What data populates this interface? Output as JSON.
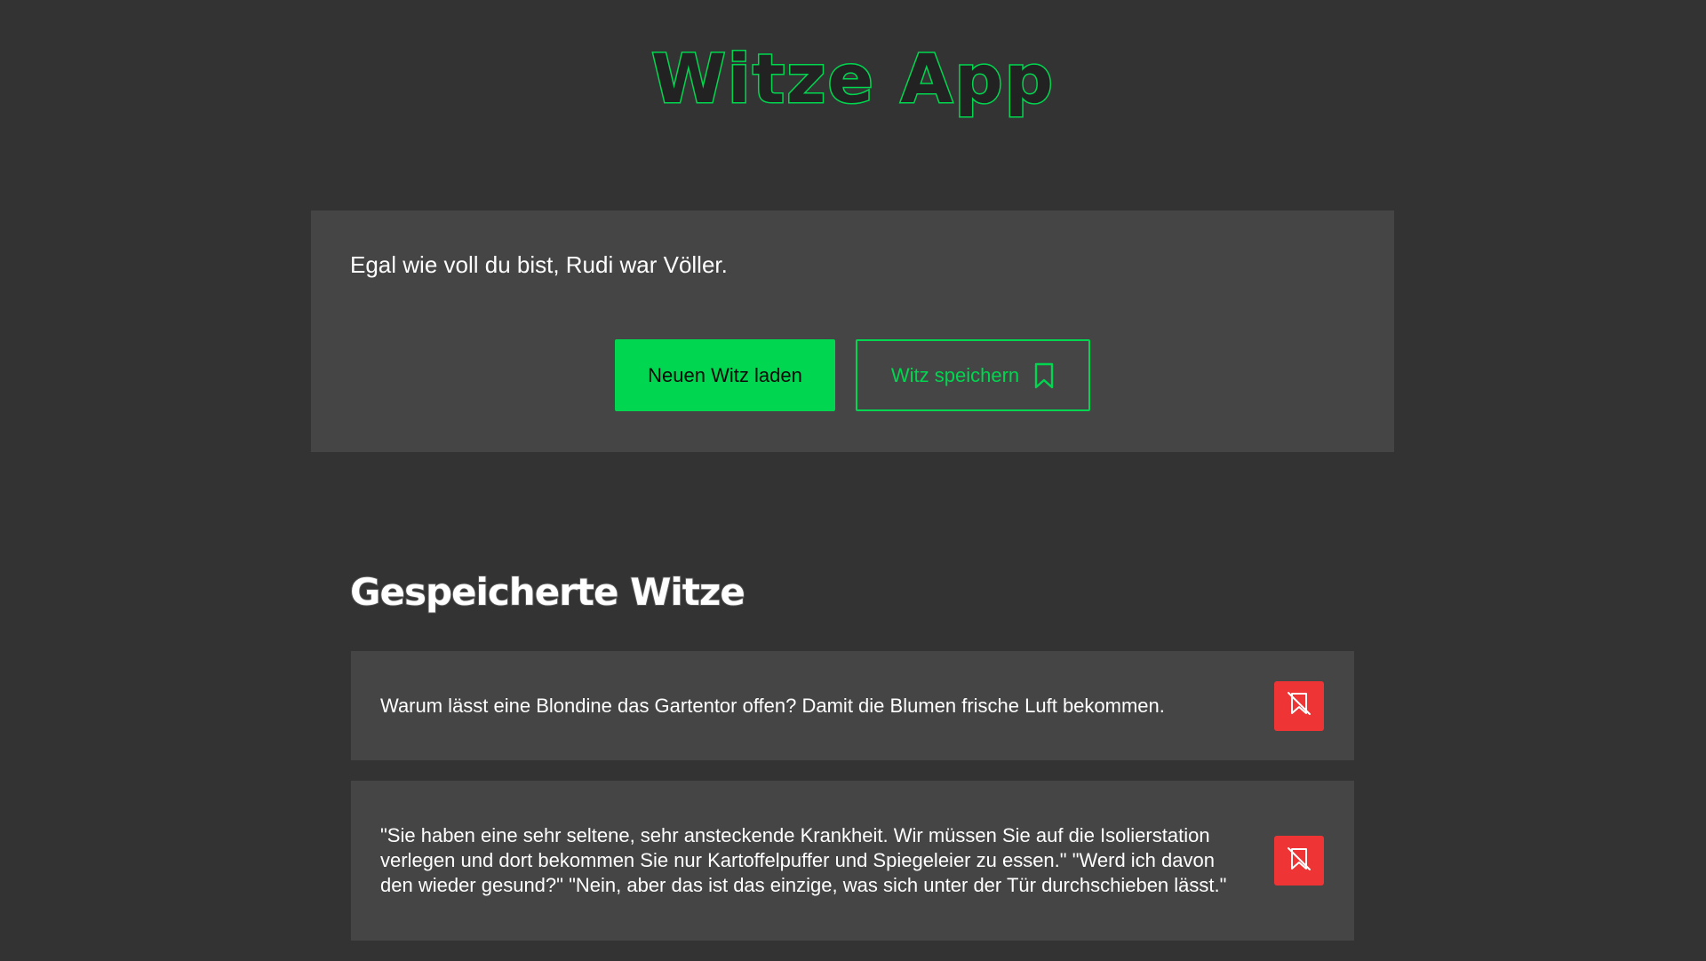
{
  "header": {
    "title": "Witze App"
  },
  "current": {
    "joke": "Egal wie voll du bist, Rudi war Völler.",
    "load_label": "Neuen Witz laden",
    "save_label": "Witz speichern",
    "save_icon": "bookmark-icon"
  },
  "saved": {
    "heading": "Gespeicherte Witze",
    "items": [
      {
        "text": "Warum lässt eine Blondine das Gartentor offen? Damit die Blumen frische Luft bekommen.",
        "delete_icon": "bookmark-remove-icon"
      },
      {
        "text": "\"Sie haben eine sehr seltene, sehr ansteckende Krankheit. Wir müssen Sie auf die Isolierstation verlegen und dort bekommen Sie nur Kartoffelpuffer und Spiegeleier zu essen.\" \"Werd ich davon den wieder gesund?\" \"Nein, aber das ist das einzige, was sich unter der Tür durchschieben lässt.\"",
        "delete_icon": "bookmark-remove-icon"
      }
    ]
  },
  "colors": {
    "background": "#333333",
    "card": "#454545",
    "accent": "#00d64f",
    "danger": "#ee3434"
  }
}
